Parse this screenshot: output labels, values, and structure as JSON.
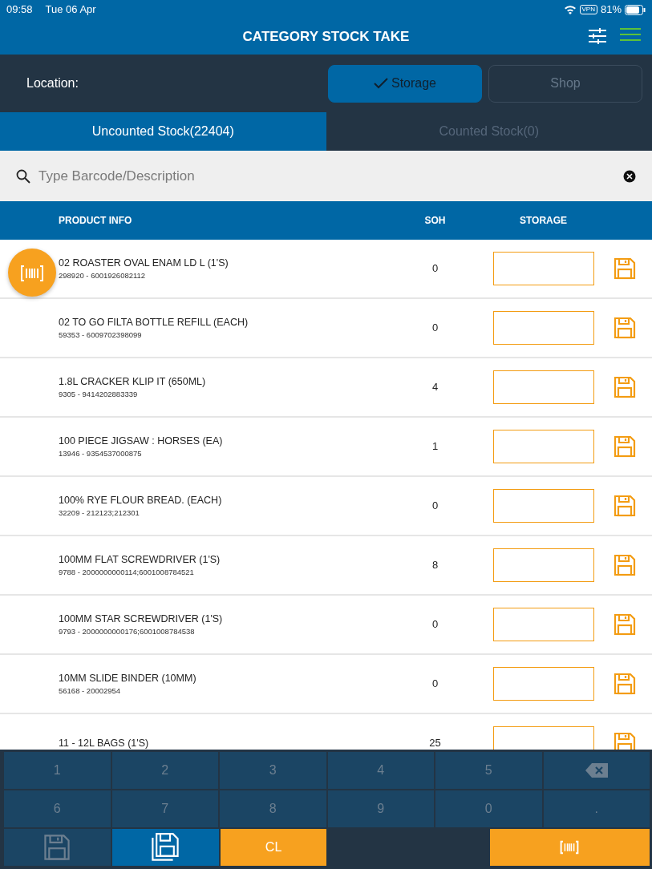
{
  "status_bar": {
    "time": "09:58",
    "date": "Tue 06 Apr",
    "vpn": "VPN",
    "battery": "81%"
  },
  "header": {
    "title": "CATEGORY STOCK TAKE"
  },
  "location": {
    "label": "Location:",
    "options": [
      {
        "label": "Storage",
        "selected": true
      },
      {
        "label": "Shop",
        "selected": false
      }
    ]
  },
  "tabs": [
    {
      "label": "Uncounted Stock(22404)",
      "selected": true
    },
    {
      "label": "Counted Stock(0)",
      "selected": false
    }
  ],
  "search": {
    "placeholder": "Type Barcode/Description"
  },
  "table": {
    "columns": [
      "PRODUCT INFO",
      "SOH",
      "STORAGE"
    ],
    "rows": [
      {
        "name": "02 ROASTER OVAL ENAM LD L (1'S)",
        "code": "298920 - 6001926082112",
        "soh": "0"
      },
      {
        "name": "02 TO GO FILTA BOTTLE REFILL (EACH)",
        "code": "59353 - 6009702398099",
        "soh": "0"
      },
      {
        "name": "1.8L CRACKER KLIP IT (650ML)",
        "code": "9305 - 9414202883339",
        "soh": "4"
      },
      {
        "name": "100 PIECE JIGSAW : HORSES (EA)",
        "code": "13946 - 9354537000875",
        "soh": "1"
      },
      {
        "name": "100% RYE FLOUR BREAD. (EACH)",
        "code": "32209 - 212123;212301",
        "soh": "0"
      },
      {
        "name": "100MM FLAT SCREWDRIVER (1'S)",
        "code": "9788 - 2000000000114;6001008784521",
        "soh": "8"
      },
      {
        "name": "100MM STAR SCREWDRIVER (1'S)",
        "code": "9793 - 2000000000176;6001008784538",
        "soh": "0"
      },
      {
        "name": "10MM SLIDE BINDER (10MM)",
        "code": "56168 - 20002954",
        "soh": "0"
      },
      {
        "name": "11 - 12L BAGS (1'S)",
        "soh": "25"
      }
    ]
  },
  "keypad": [
    [
      {
        "kind": "digit",
        "label": "1"
      },
      {
        "kind": "digit",
        "label": "2"
      },
      {
        "kind": "digit",
        "label": "3"
      },
      {
        "kind": "digit",
        "label": "4"
      },
      {
        "kind": "digit",
        "label": "5"
      },
      {
        "kind": "backspace"
      }
    ],
    [
      {
        "kind": "digit",
        "label": "6"
      },
      {
        "kind": "digit",
        "label": "7"
      },
      {
        "kind": "digit",
        "label": "8"
      },
      {
        "kind": "digit",
        "label": "9"
      },
      {
        "kind": "digit",
        "label": "0"
      },
      {
        "kind": "digit",
        "label": "."
      }
    ],
    [
      {
        "kind": "save"
      },
      {
        "kind": "save-all"
      },
      {
        "kind": "clear",
        "label": "CL"
      },
      {
        "kind": "blank"
      },
      {
        "kind": "scan"
      }
    ]
  ]
}
